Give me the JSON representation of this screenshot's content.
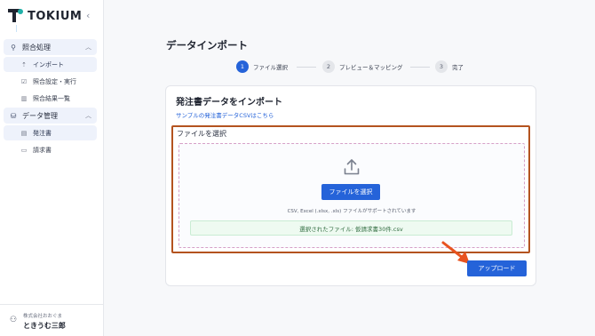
{
  "app": {
    "logo_text": "TOKIUM"
  },
  "sidebar": {
    "groups": [
      {
        "label": "照合処理",
        "items": [
          {
            "label": "インポート"
          },
          {
            "label": "照合設定・実行"
          },
          {
            "label": "照合結果一覧"
          }
        ]
      },
      {
        "label": "データ管理",
        "items": [
          {
            "label": "発注書"
          },
          {
            "label": "請求書"
          }
        ]
      }
    ],
    "user": {
      "company": "株式会社おおぐま",
      "name": "ときうむ三郎"
    }
  },
  "main": {
    "page_title": "データインポート",
    "steps": [
      {
        "num": "1",
        "label": "ファイル選択"
      },
      {
        "num": "2",
        "label": "プレビュー＆マッピング"
      },
      {
        "num": "3",
        "label": "完了"
      }
    ],
    "card": {
      "title": "発注書データをインポート",
      "sample_link": "サンプルの発注書データCSVはこちら",
      "select_label": "ファイルを選択",
      "choose_button": "ファイルを選択",
      "support_text": "CSV, Excel (.xlsx, .xls) ファイルがサポートされています",
      "selected_file": "選択されたファイル: 仮請求書30件.csv"
    },
    "upload_button": "アップロード"
  },
  "colors": {
    "accent": "#2563d9",
    "highlight": "#b4531f",
    "arrow": "#e8531f"
  }
}
